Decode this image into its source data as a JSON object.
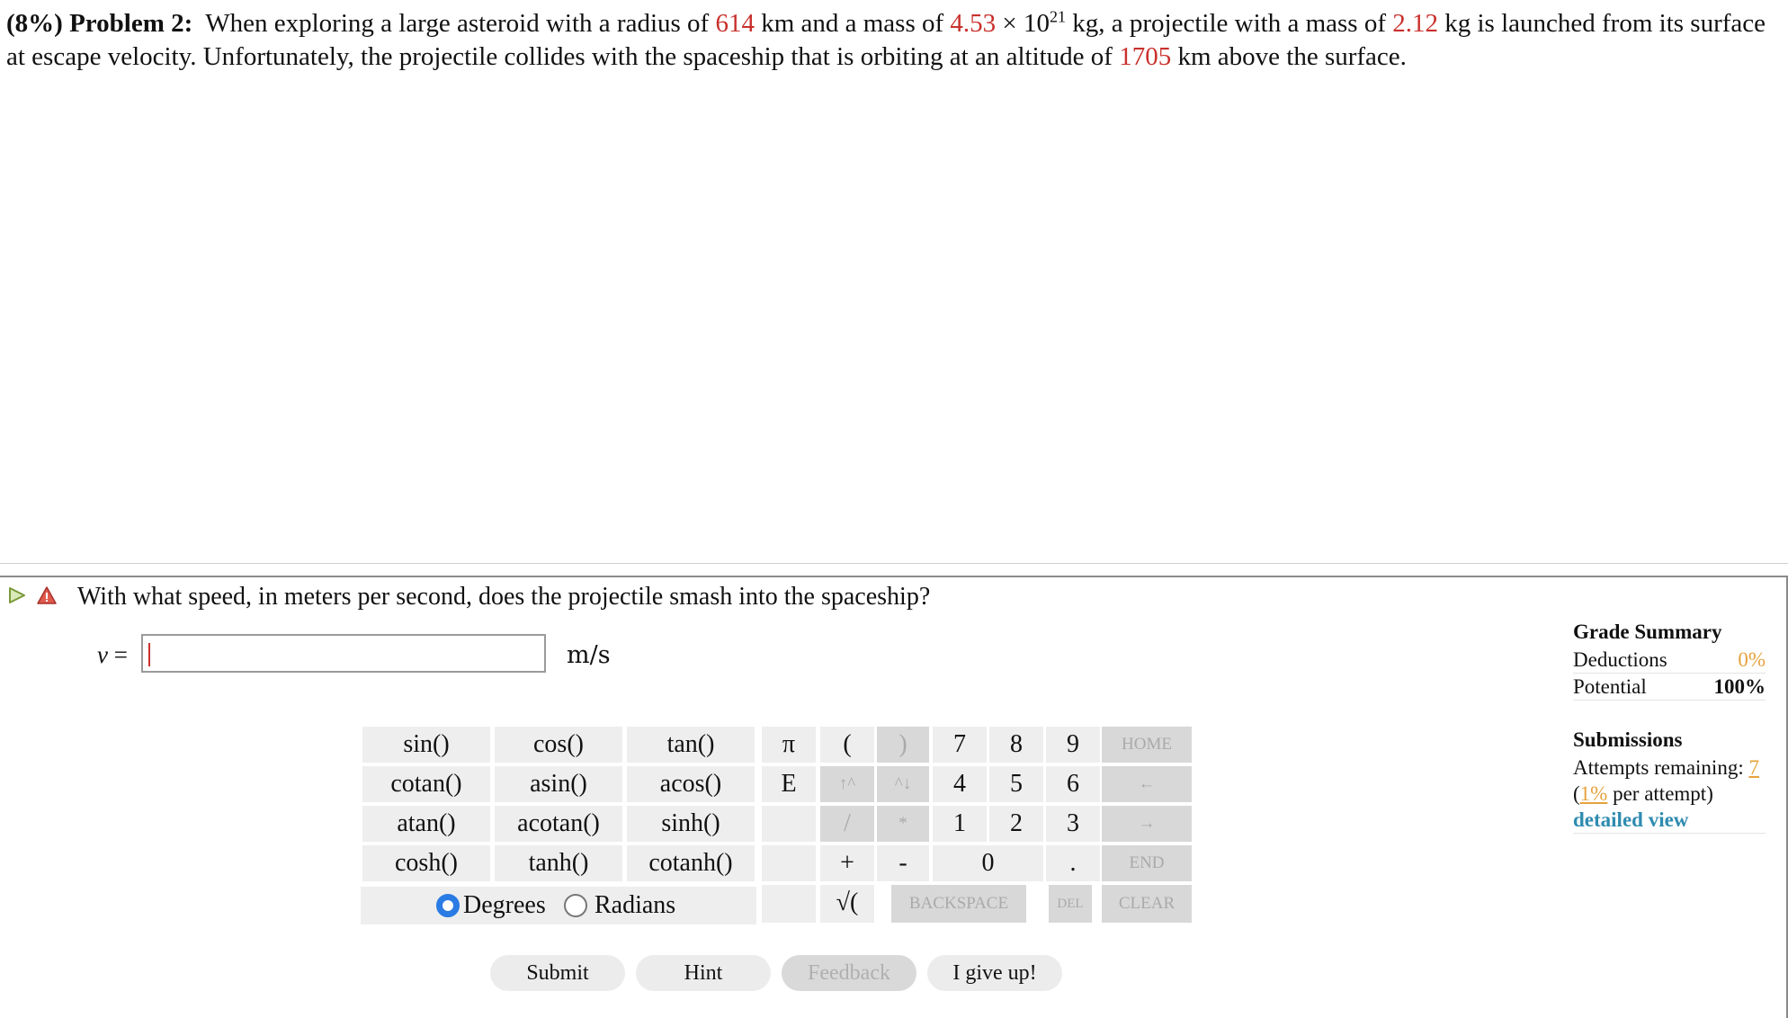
{
  "problem": {
    "weight": "(8%)",
    "label": "Problem 2:",
    "text1": "When exploring a large asteroid with a radius of ",
    "radius": "614",
    "text2": " km and a mass of ",
    "mass_mantissa": "4.53",
    "times": " × 10",
    "mass_exp": "21",
    "text3": " kg, a projectile with a mass of ",
    "proj_mass": "2.12",
    "text4": " kg is launched from its surface at escape velocity. Unfortunately, the projectile collides with the spaceship that is orbiting at an altitude of ",
    "altitude": "1705",
    "text5": " km above the surface."
  },
  "question": {
    "text": "With what speed, in meters per second, does the projectile smash into the spaceship?",
    "var_label": "v",
    "equals": " =",
    "input_value": "",
    "units": "m/s"
  },
  "keypad": {
    "functions": [
      "sin()",
      "cos()",
      "tan()",
      "cotan()",
      "asin()",
      "acos()",
      "atan()",
      "acotan()",
      "sinh()",
      "cosh()",
      "tanh()",
      "cotanh()"
    ],
    "pi": "π",
    "e": "E",
    "open_paren": "(",
    "close_paren": ")",
    "up_arrow": "↑^",
    "down_arrow": "^↓",
    "divide": "/",
    "multiply": "*",
    "plus": "+",
    "minus": "-",
    "sqrt": "√(",
    "digits": [
      "7",
      "8",
      "9",
      "4",
      "5",
      "6",
      "1",
      "2",
      "3",
      "0",
      "."
    ],
    "home": "HOME",
    "left": "←",
    "right": "→",
    "end": "END",
    "backspace": "BACKSPACE",
    "del": "DEL",
    "clear": "CLEAR",
    "degrees": "Degrees",
    "radians": "Radians",
    "angle_mode": "Degrees"
  },
  "buttons": {
    "submit": "Submit",
    "hint": "Hint",
    "feedback": "Feedback",
    "give_up": "I give up!"
  },
  "summary": {
    "title": "Grade Summary",
    "deductions_label": "Deductions",
    "deductions_value": "0%",
    "potential_label": "Potential",
    "potential_value": "100%",
    "submissions_title": "Submissions",
    "attempts_label": "Attempts remaining: ",
    "attempts_value": "7",
    "per_attempt_open": "(",
    "per_attempt_value": "1%",
    "per_attempt_text": " per attempt)",
    "detailed_view": "detailed view"
  },
  "colors": {
    "highlight": "#c9302c",
    "accent_orange": "#e6a23c",
    "link": "#2e8bb0",
    "radio_selected": "#2a7be4"
  }
}
